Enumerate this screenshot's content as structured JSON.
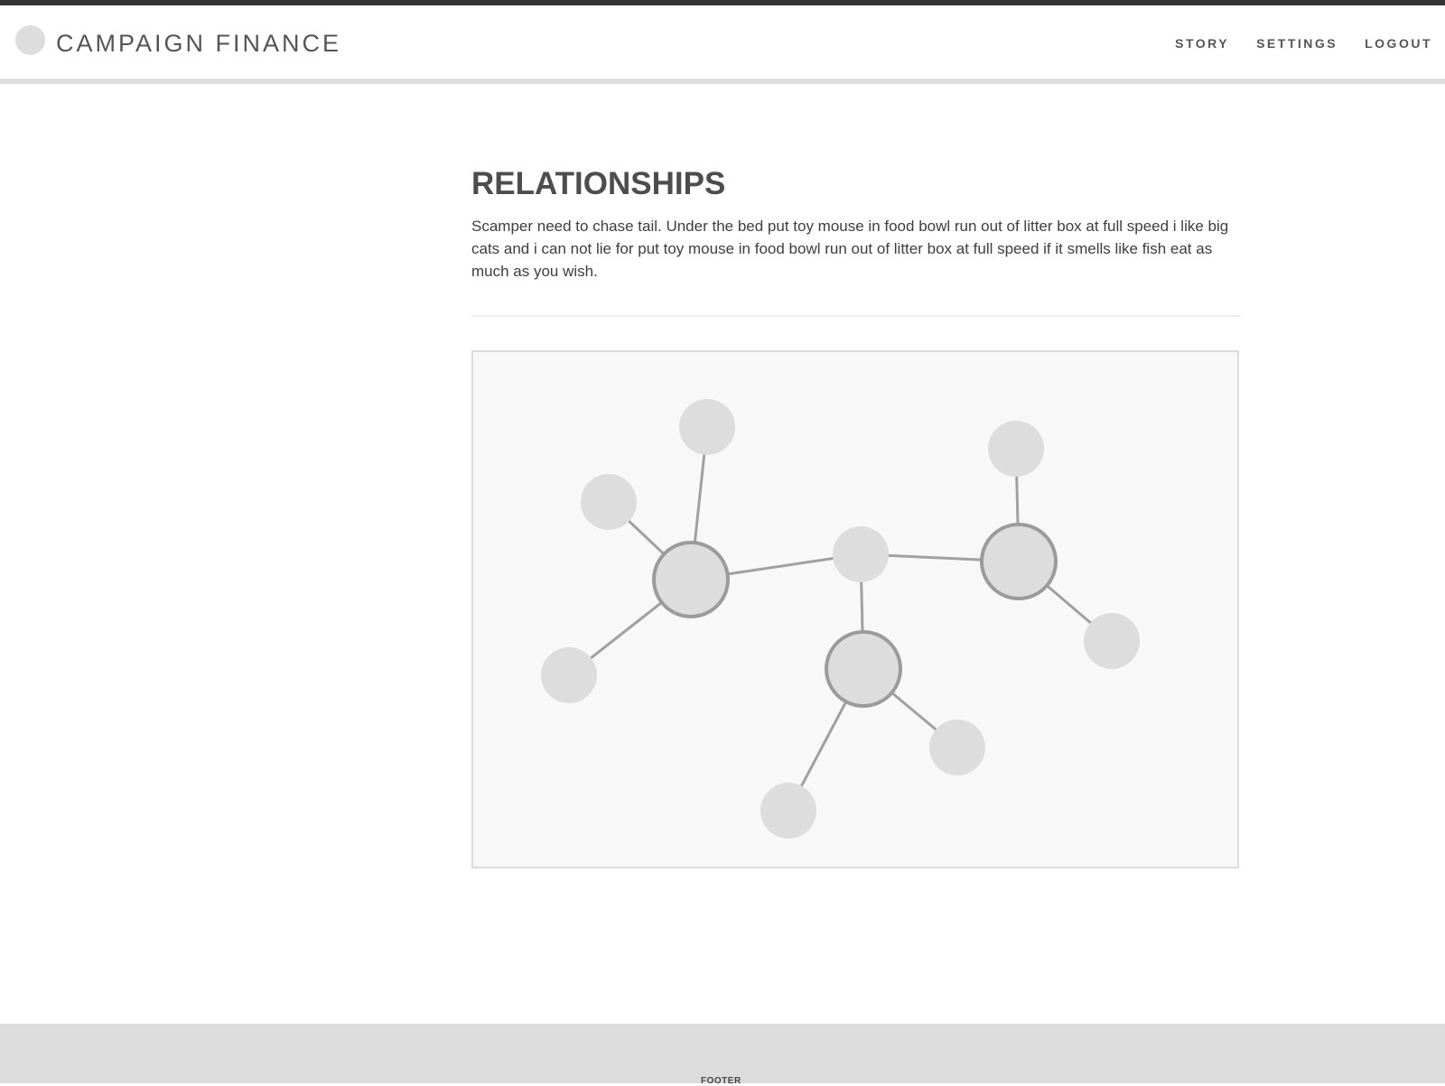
{
  "header": {
    "title": "CAMPAIGN FINANCE",
    "nav": [
      "STORY",
      "SETTINGS",
      "LOGOUT"
    ]
  },
  "main": {
    "title": "RELATIONSHIPS",
    "intro": "Scamper need to chase tail. Under the bed put toy mouse in food bowl run out of litter box at full speed i like big cats and i can not lie for put toy mouse in food bowl run out of litter box at full speed if it smells like fish eat as much as you wish."
  },
  "graph": {
    "node_fill": "#dddddd",
    "hub_stroke": "#9b9b9b",
    "edge_color": "#a0a0a0",
    "panel_bg": "#f8f8f8",
    "nodes": [
      {
        "id": "hub-a",
        "type": "hub"
      },
      {
        "id": "hub-b",
        "type": "hub"
      },
      {
        "id": "hub-c",
        "type": "hub"
      },
      {
        "id": "center",
        "type": "leaf"
      },
      {
        "id": "a1",
        "type": "leaf"
      },
      {
        "id": "a2",
        "type": "leaf"
      },
      {
        "id": "a3",
        "type": "leaf"
      },
      {
        "id": "b1",
        "type": "leaf"
      },
      {
        "id": "b2",
        "type": "leaf"
      },
      {
        "id": "c1",
        "type": "leaf"
      },
      {
        "id": "c2",
        "type": "leaf"
      }
    ],
    "edges": [
      [
        "hub-a",
        "center"
      ],
      [
        "center",
        "hub-b"
      ],
      [
        "center",
        "hub-c"
      ],
      [
        "hub-a",
        "a1"
      ],
      [
        "hub-a",
        "a2"
      ],
      [
        "hub-a",
        "a3"
      ],
      [
        "hub-b",
        "b1"
      ],
      [
        "hub-b",
        "b2"
      ],
      [
        "hub-c",
        "c1"
      ],
      [
        "hub-c",
        "c2"
      ]
    ]
  },
  "footer": {
    "label": "FOOTER"
  }
}
